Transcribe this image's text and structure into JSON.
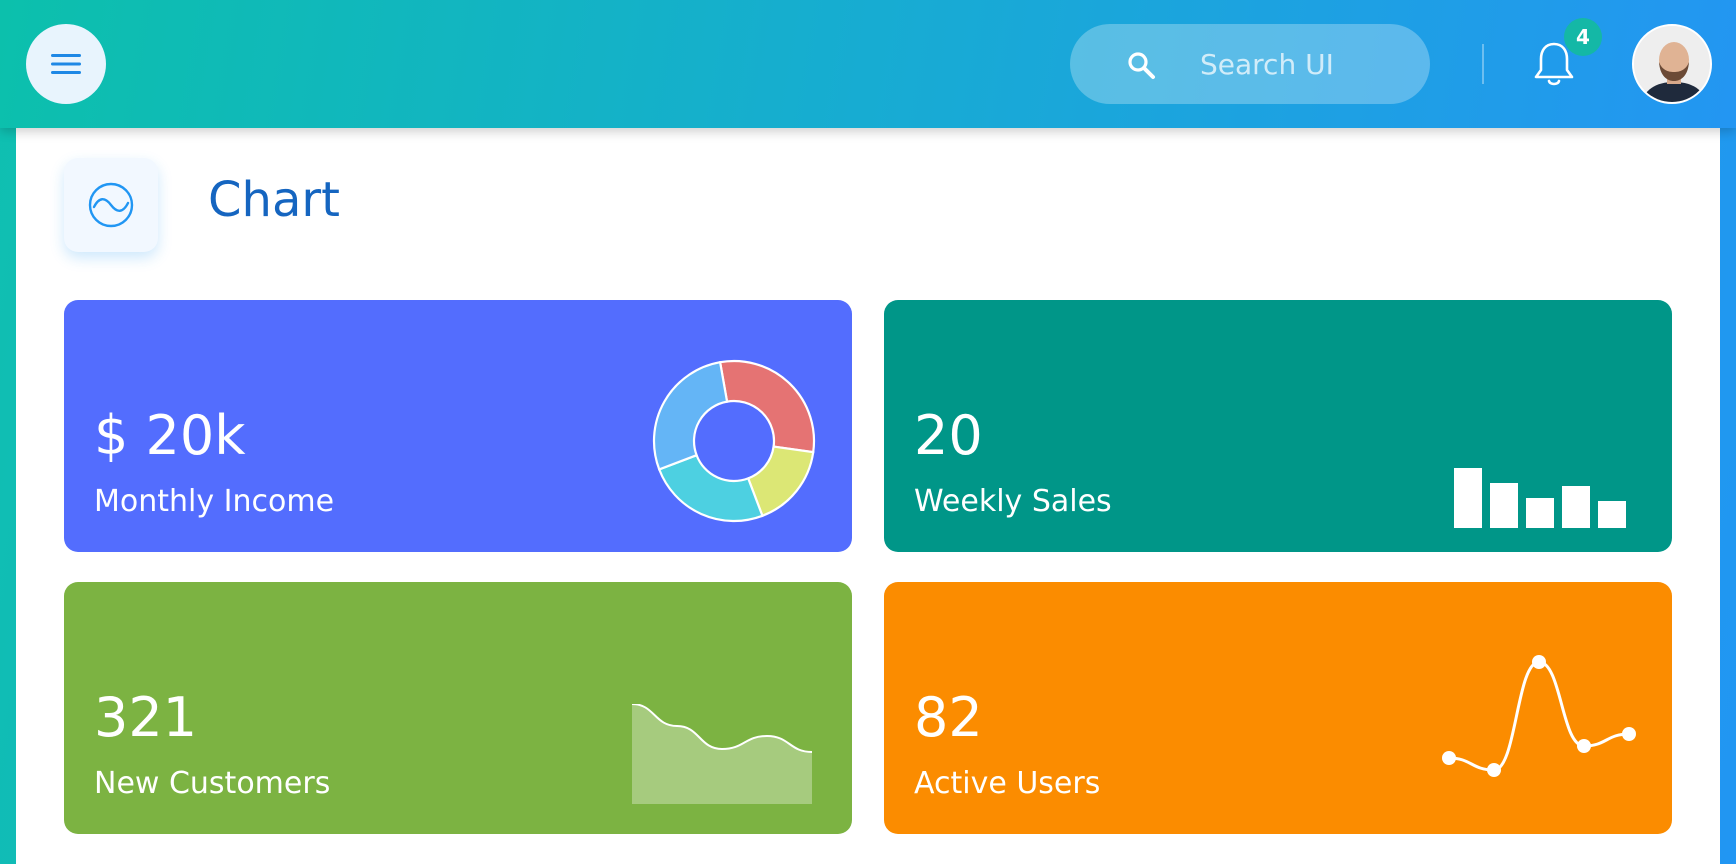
{
  "header": {
    "search": {
      "placeholder": "Search UI"
    },
    "notifications": {
      "count": "4"
    }
  },
  "page": {
    "title": "Chart"
  },
  "cards": [
    {
      "value": "$ 20k",
      "label": "Monthly Income",
      "color": "#536dfe",
      "mini_chart": {
        "type": "pie",
        "slices": [
          {
            "value": 30,
            "color": "#e57373"
          },
          {
            "value": 17,
            "color": "#dce775"
          },
          {
            "value": 25,
            "color": "#4dd0e1"
          },
          {
            "value": 28,
            "color": "#64b5f6"
          }
        ]
      }
    },
    {
      "value": "20",
      "label": "Weekly Sales",
      "color": "#009688",
      "mini_chart": {
        "type": "bar",
        "values": [
          10,
          7.5,
          5,
          7,
          4.5
        ]
      }
    },
    {
      "value": "321",
      "label": "New Customers",
      "color": "#7cb342",
      "mini_chart": {
        "type": "area",
        "values": [
          10,
          7.8,
          5.5,
          6.8,
          5.2
        ]
      }
    },
    {
      "value": "82",
      "label": "Active Users",
      "color": "#fb8c00",
      "mini_chart": {
        "type": "line",
        "values": [
          2,
          1,
          10,
          3,
          4
        ]
      }
    }
  ]
}
